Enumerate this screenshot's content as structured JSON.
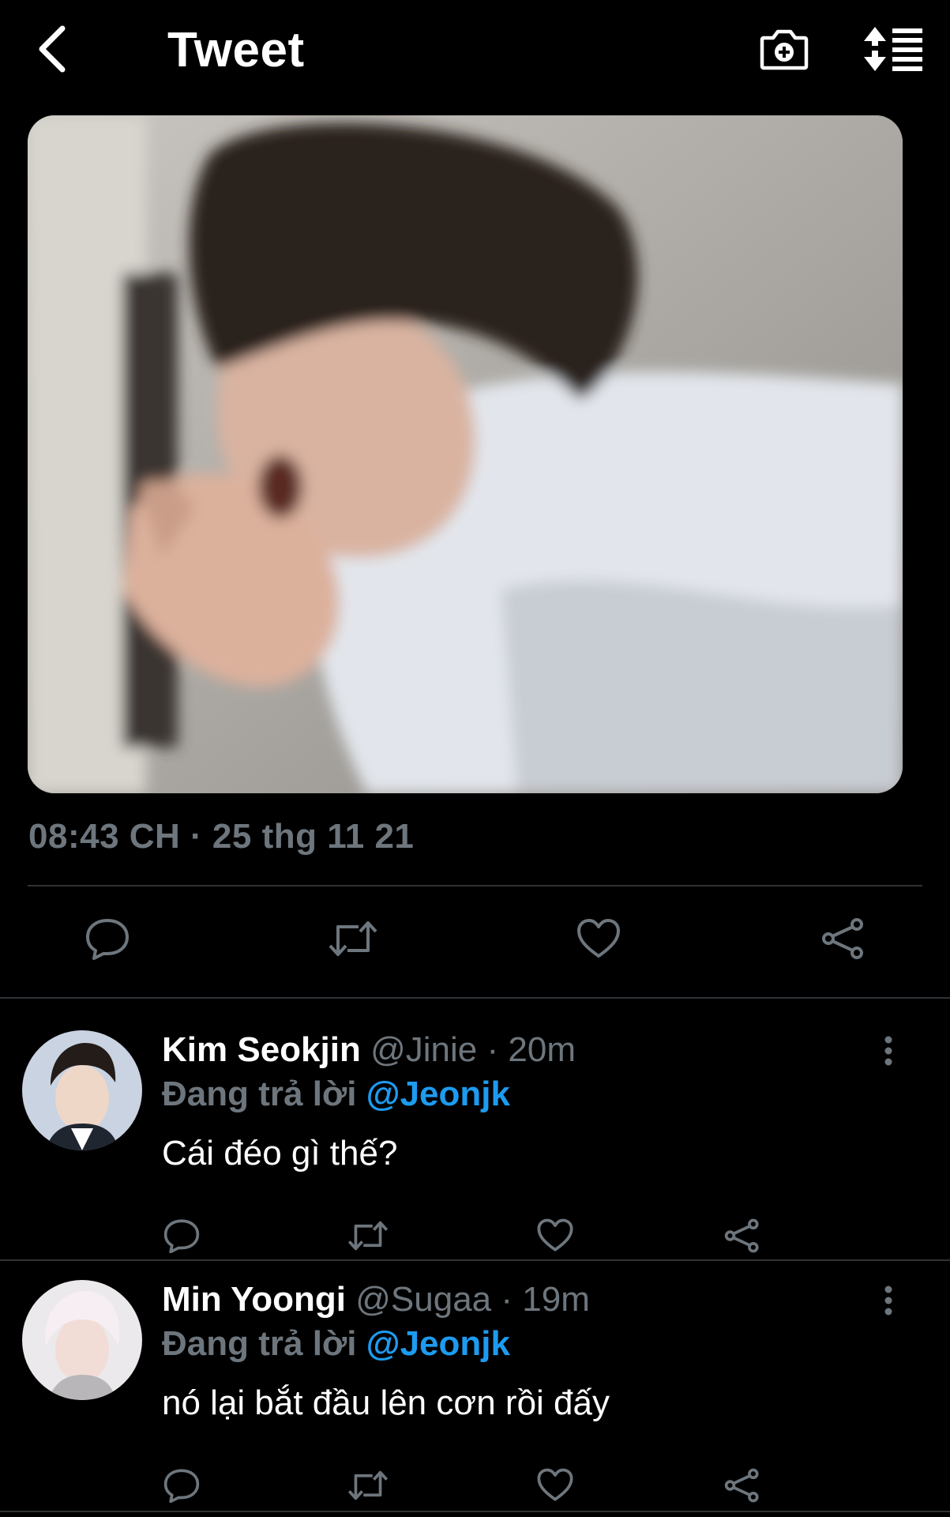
{
  "header": {
    "title": "Tweet",
    "back_icon": "chevron-left-icon",
    "camera_icon": "camera-add-icon",
    "sort_icon": "sort-list-icon"
  },
  "tweet": {
    "timestamp": "08:43 CH · 25 thg 11 21",
    "actions": [
      "reply-icon",
      "retweet-icon",
      "like-icon",
      "share-icon"
    ]
  },
  "replies": [
    {
      "name": "Kim Seokjin",
      "handle": "@Jinie",
      "dot": "·",
      "time": "20m",
      "reply_label": "Đang trả lời",
      "reply_mention": "@Jeonjk",
      "text": "Cái đéo gì thế?"
    },
    {
      "name": "Min Yoongi",
      "handle": "@Sugaa",
      "dot": "·",
      "time": "19m",
      "reply_label": "Đang trả lời",
      "reply_mention": "@Jeonjk",
      "text": "nó lại bắt đầu lên cơn rồi đấy"
    }
  ],
  "colors": {
    "background": "#000000",
    "text_primary": "#ffffff",
    "text_secondary": "#6e767d",
    "accent": "#1d9bf0",
    "divider": "#2f3336"
  }
}
